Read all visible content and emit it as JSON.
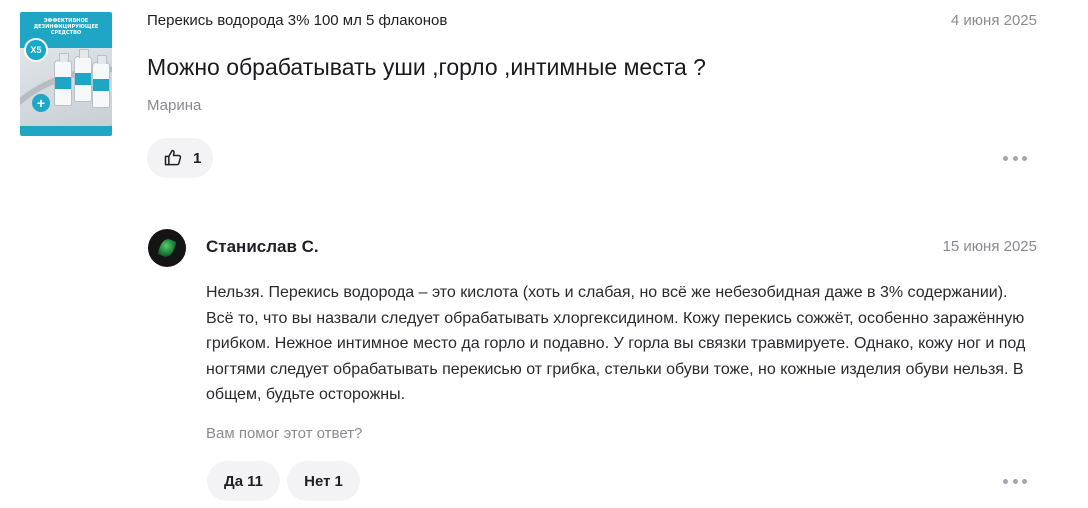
{
  "question": {
    "product_name": "Перекись водорода 3% 100 мл 5 флаконов",
    "date": "4 июня 2025",
    "text": "Можно обрабатывать уши ,горло ,интимные места ?",
    "author": "Марина",
    "likes": "1",
    "thumbnail": {
      "banner_text": "ЭФФЕКТИВНОЕ ДЕЗИНФИЦИРУЮЩЕЕ СРЕДСТВО",
      "badge": "X5",
      "cross": "+"
    }
  },
  "answer": {
    "author": "Станислав С.",
    "date": "15 июня 2025",
    "text": "Нельзя. Перекись водорода – это кислота (хоть и слабая, но всё же небезобидная даже в 3% содержании). Всё то, что вы назвали следует обрабатывать хлоргексидином. Кожу перекись сожжёт, особенно заражённую грибком. Нежное интимное место да горло и подавно. У горла вы связки травмируете. Однако, кожу ног и под ногтями следует обрабатывать перекисью от грибка, стельки обуви тоже, но кожные изделия обуви нельзя. В общем, будьте осторожны.",
    "helpful_question": "Вам помог этот ответ?",
    "yes_label": "Да",
    "yes_count": "11",
    "no_label": "Нет",
    "no_count": "1"
  },
  "icons": {
    "like": "thumbs-up-icon",
    "more": "more-dots-icon"
  },
  "colors": {
    "muted_text": "#8a8a93",
    "button_bg": "#f3f3f6",
    "brand_teal": "#1fa6c4"
  }
}
